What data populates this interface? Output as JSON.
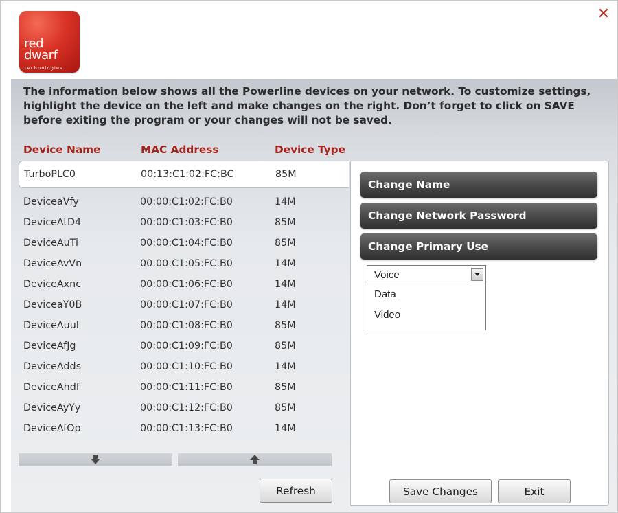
{
  "header": {
    "logo_line1": "red",
    "logo_line2": "dwarf",
    "logo_sub": "technologies",
    "close_glyph": "✕"
  },
  "intro_text": "The information below shows all the Powerline devices on your network. To customize settings, highlight the device on the left and make changes on the right. Don’t forget to click on SAVE before exiting the program or your changes will not be saved.",
  "columns": {
    "device_name": "Device Name",
    "mac_address": "MAC Address",
    "device_type": "Device Type"
  },
  "devices": [
    {
      "name": "TurboPLC0",
      "mac": "00:13:C1:02:FC:BC",
      "type": "85M"
    },
    {
      "name": "DeviceaVfy",
      "mac": "00:00:C1:02:FC:B0",
      "type": "14M"
    },
    {
      "name": "DeviceAtD4",
      "mac": "00:00:C1:03:FC:B0",
      "type": "85M"
    },
    {
      "name": "DeviceAuTi",
      "mac": "00:00:C1:04:FC:B0",
      "type": "85M"
    },
    {
      "name": "DeviceAvVn",
      "mac": "00:00:C1:05:FC:B0",
      "type": "14M"
    },
    {
      "name": "DeviceAxnc",
      "mac": "00:00:C1:06:FC:B0",
      "type": "14M"
    },
    {
      "name": "DeviceaY0B",
      "mac": "00:00:C1:07:FC:B0",
      "type": "14M"
    },
    {
      "name": "DeviceAuuI",
      "mac": "00:00:C1:08:FC:B0",
      "type": "85M"
    },
    {
      "name": "DeviceAfJg",
      "mac": "00:00:C1:09:FC:B0",
      "type": "85M"
    },
    {
      "name": "DeviceAdds",
      "mac": "00:00:C1:10:FC:B0",
      "type": "14M"
    },
    {
      "name": "DeviceAhdf",
      "mac": "00:00:C1:11:FC:B0",
      "type": "85M"
    },
    {
      "name": "DeviceAyYy",
      "mac": "00:00:C1:12:FC:B0",
      "type": "85M"
    },
    {
      "name": "DeviceAfOp",
      "mac": "00:00:C1:13:FC:B0",
      "type": "14M"
    }
  ],
  "actions": {
    "change_name": "Change Name",
    "change_password": "Change Network Password",
    "change_primary_use": "Change Primary Use"
  },
  "primary_use": {
    "selected": "Voice",
    "options": [
      "Data",
      "Video"
    ]
  },
  "buttons": {
    "refresh": "Refresh",
    "save": "Save Changes",
    "exit": "Exit"
  },
  "icons": {
    "close": "close-icon",
    "scroll_down": "arrow-down-icon",
    "scroll_up": "arrow-up-icon",
    "dropdown": "chevron-down-icon"
  },
  "colors": {
    "accent_red": "#a3231d",
    "button_dark": "#4a4a4a",
    "logo_red": "#d83226"
  }
}
